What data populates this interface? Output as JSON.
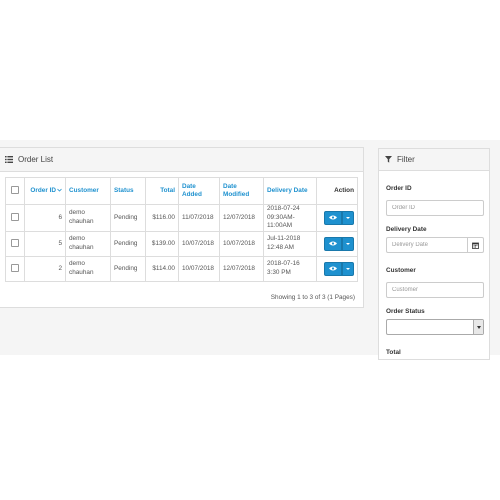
{
  "order_list": {
    "title": "Order List",
    "columns": {
      "order_id": "Order ID",
      "customer": "Customer",
      "status": "Status",
      "total": "Total",
      "date_added": "Date Added",
      "date_modified": "Date Modified",
      "delivery_date": "Delivery Date",
      "action": "Action"
    },
    "sort_indicator": "order_id descending",
    "rows": [
      {
        "order_id": "6",
        "customer": "demo chauhan",
        "status": "Pending",
        "total": "$116.00",
        "date_added": "11/07/2018",
        "date_modified": "12/07/2018",
        "delivery_date": "2018-07-24 09:30AM-11:00AM"
      },
      {
        "order_id": "5",
        "customer": "demo chauhan",
        "status": "Pending",
        "total": "$139.00",
        "date_added": "10/07/2018",
        "date_modified": "10/07/2018",
        "delivery_date": "Jul-11-2018 12:48 AM"
      },
      {
        "order_id": "2",
        "customer": "demo chauhan",
        "status": "Pending",
        "total": "$114.00",
        "date_added": "10/07/2018",
        "date_modified": "12/07/2018",
        "delivery_date": "2018-07-16 3:30 PM"
      }
    ],
    "pagination_text": "Showing 1 to 3 of 3 (1 Pages)",
    "icons": {
      "heading": "list-icon",
      "view": "eye-icon",
      "dropdown": "caret-down-icon"
    }
  },
  "filter": {
    "title": "Filter",
    "order_id_label": "Order ID",
    "order_id_placeholder": "Order ID",
    "delivery_date_label": "Delivery Date",
    "delivery_date_placeholder": "Delivery Date",
    "customer_label": "Customer",
    "customer_placeholder": "Customer",
    "order_status_label": "Order Status",
    "order_status_value": "",
    "total_label": "Total",
    "icons": {
      "heading": "filter-icon",
      "calendar": "calendar-icon"
    }
  },
  "colors": {
    "accent": "#1e91cf",
    "panel_heading_bg": "#f5f5f5",
    "border": "#dddddd"
  }
}
